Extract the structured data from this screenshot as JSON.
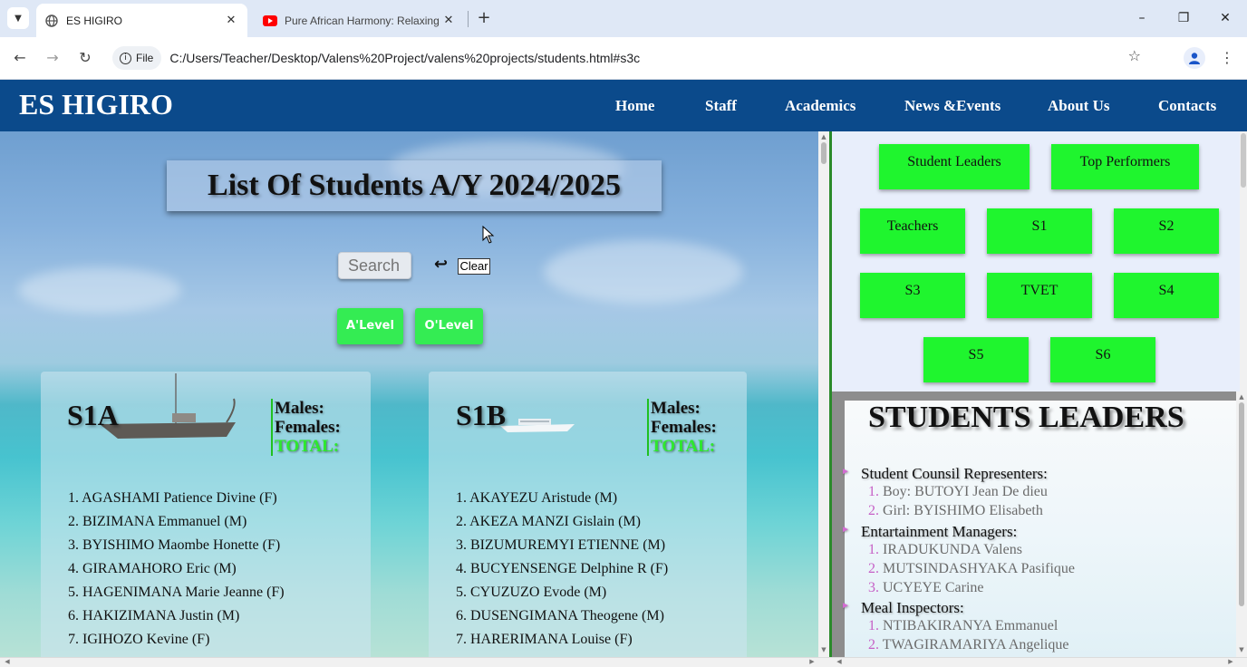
{
  "browser": {
    "tabs": [
      {
        "title": "ES HIGIRO",
        "active": true,
        "favicon": "globe-icon"
      },
      {
        "title": "Pure African Harmony: Relaxing",
        "active": false,
        "favicon": "youtube-icon"
      }
    ],
    "chip_label": "File",
    "url": "C:/Users/Teacher/Desktop/Valens%20Project/valens%20projects/students.html#s3c"
  },
  "site": {
    "title": "ES HIGIRO",
    "nav": [
      "Home",
      "Staff",
      "Academics",
      "News &Events",
      "About Us",
      "Contacts"
    ]
  },
  "main": {
    "heading": "List Of Students A/Y 2024/2025",
    "search_placeholder": "Search",
    "clear_label": "Clear",
    "level_buttons": [
      "A'Level",
      "O'Level"
    ],
    "stats_labels": {
      "males": "Males:",
      "females": "Females:",
      "total": "TOTAL:"
    },
    "classes": [
      {
        "name": "S1A",
        "students": [
          "1. AGASHAMI Patience Divine (F)",
          "2. BIZIMANA Emmanuel (M)",
          "3. BYISHIMO Maombe Honette (F)",
          "4. GIRAMAHORO Eric (M)",
          "5. HAGENIMANA Marie Jeanne (F)",
          "6. HAKIZIMANA Justin (M)",
          "7. IGIHOZO Kevine (F)"
        ]
      },
      {
        "name": "S1B",
        "students": [
          "1. AKAYEZU Aristude (M)",
          "2. AKEZA MANZI Gislain (M)",
          "3. BIZUMUREMYI ETIENNE (M)",
          "4. BUCYENSENGE Delphine R (F)",
          "5. CYUZUZO Evode (M)",
          "6. DUSENGIMANA Theogene (M)",
          "7. HARERIMANA Louise (F)"
        ]
      }
    ]
  },
  "sidebar": {
    "buttons": [
      "Student Leaders",
      "Top Performers",
      "Teachers",
      "S1",
      "S2",
      "S3",
      "TVET",
      "S4",
      "S5",
      "S6"
    ],
    "leaders_title": "STUDENTS LEADERS",
    "groups": [
      {
        "role": "Student Counsil Representers:",
        "members": [
          "Boy: BUTOYI Jean De dieu",
          "Girl: BYISHIMO Elisabeth"
        ]
      },
      {
        "role": "Entartainment Managers:",
        "members": [
          "IRADUKUNDA Valens",
          "MUTSINDASHYAKA Pasifique",
          "UCYEYE Carine"
        ]
      },
      {
        "role": "Meal Inspectors:",
        "members": [
          "NTIBAKIRANYA Emmanuel",
          "TWAGIRAMARIYA Angelique"
        ]
      }
    ]
  },
  "colors": {
    "header_blue": "#0b4a8b",
    "button_green": "#1ff52e",
    "level_green": "#34ec53",
    "total_green": "#2ee82e"
  }
}
